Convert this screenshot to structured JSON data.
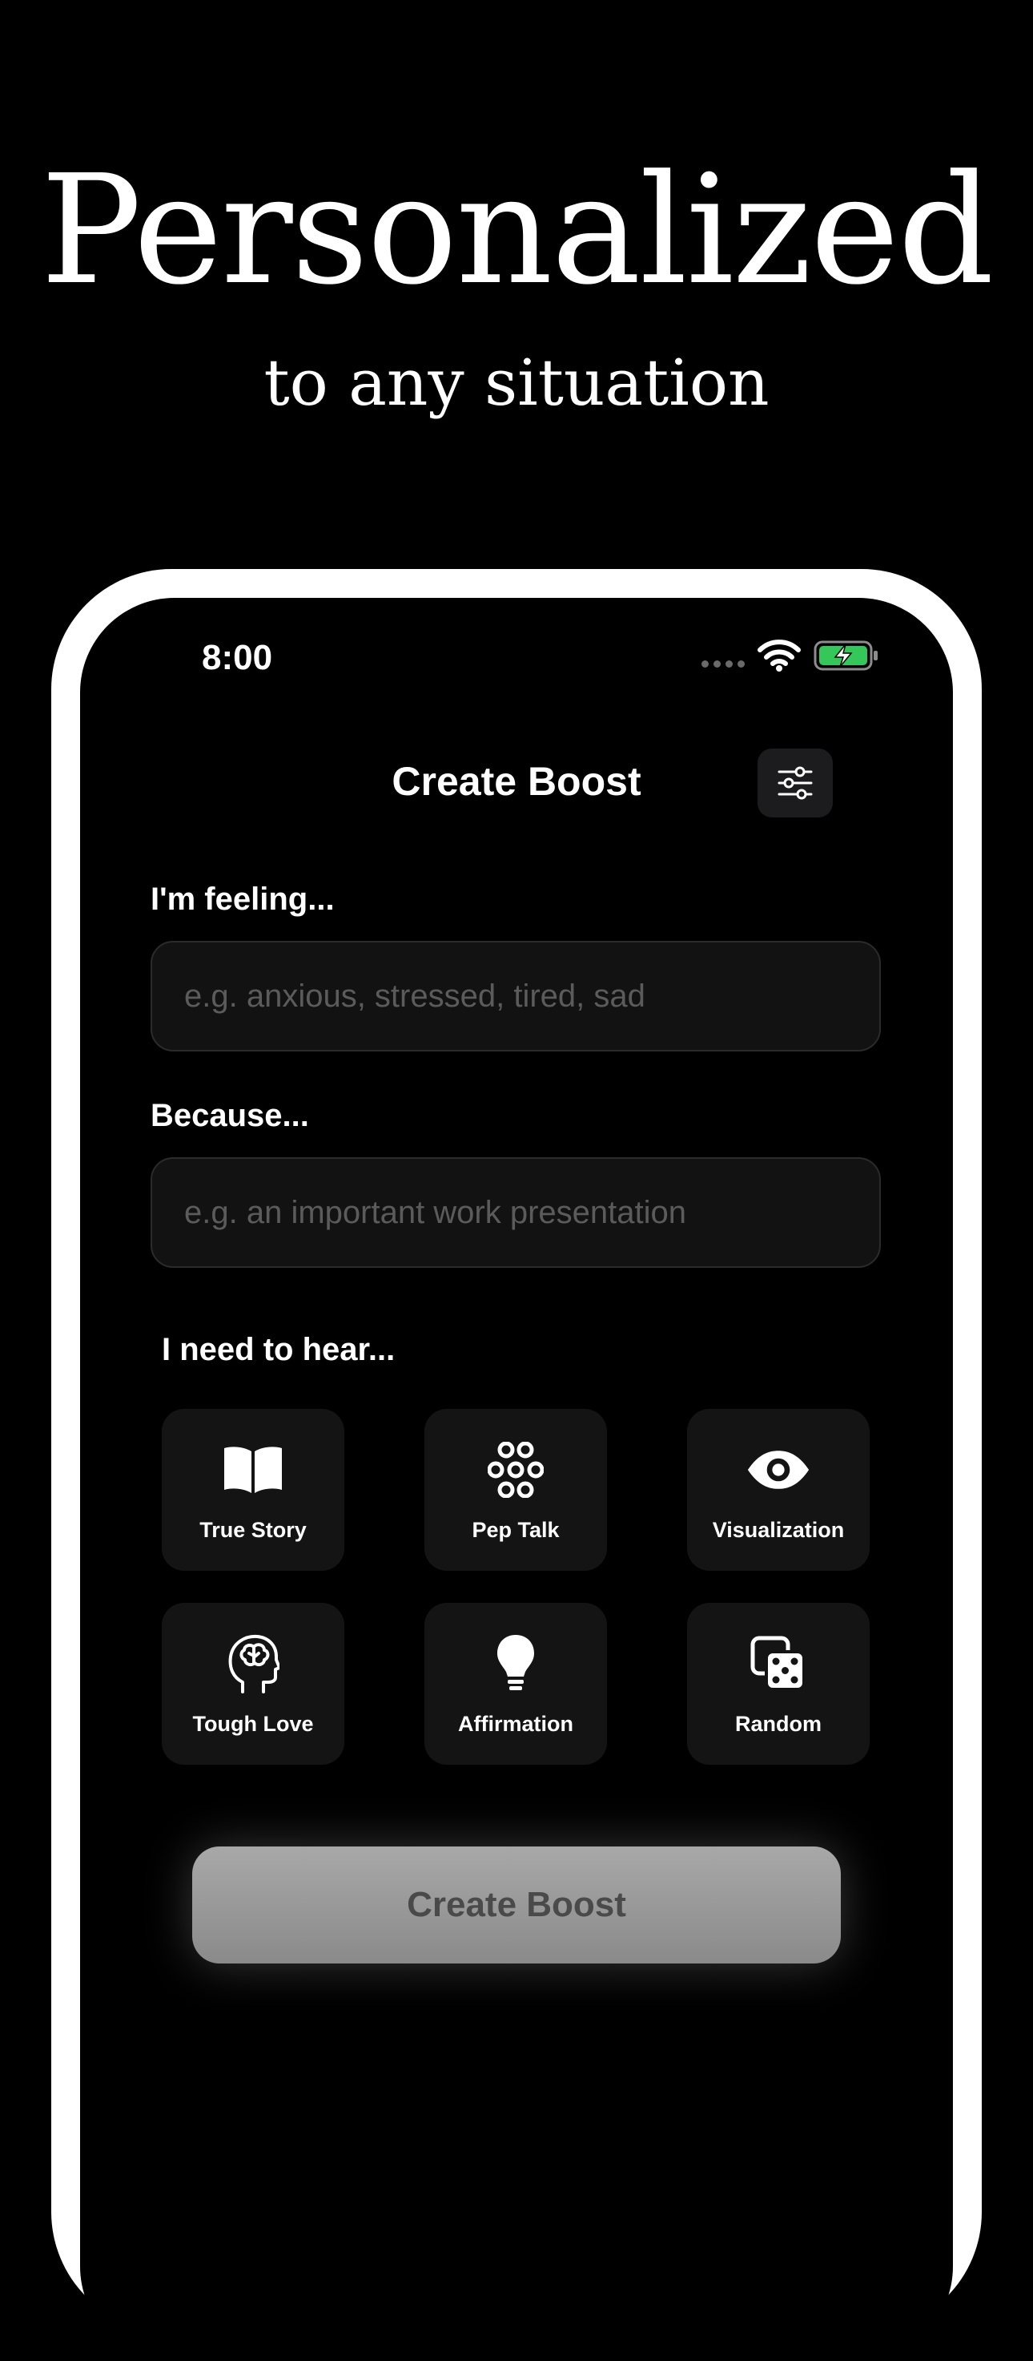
{
  "hero": {
    "headline": "Personalized",
    "subheadline": "to any situation"
  },
  "status_bar": {
    "time": "8:00",
    "battery_color": "#34C759"
  },
  "nav": {
    "title": "Create Boost",
    "filter_icon": "sliders-icon"
  },
  "form": {
    "feeling_label": "I'm feeling...",
    "feeling_placeholder": "e.g. anxious, stressed, tired, sad",
    "feeling_value": "",
    "because_label": "Because...",
    "because_placeholder": "e.g. an important work presentation",
    "because_value": "",
    "need_label": "I need to hear..."
  },
  "options": [
    {
      "label": "True Story",
      "icon": "open-book-icon"
    },
    {
      "label": "Pep Talk",
      "icon": "flower-dots-icon"
    },
    {
      "label": "Visualization",
      "icon": "eye-icon"
    },
    {
      "label": "Tough Love",
      "icon": "head-brain-icon"
    },
    {
      "label": "Affirmation",
      "icon": "lightbulb-icon"
    },
    {
      "label": "Random",
      "icon": "dice-icon"
    }
  ],
  "submit": {
    "label": "Create Boost"
  }
}
